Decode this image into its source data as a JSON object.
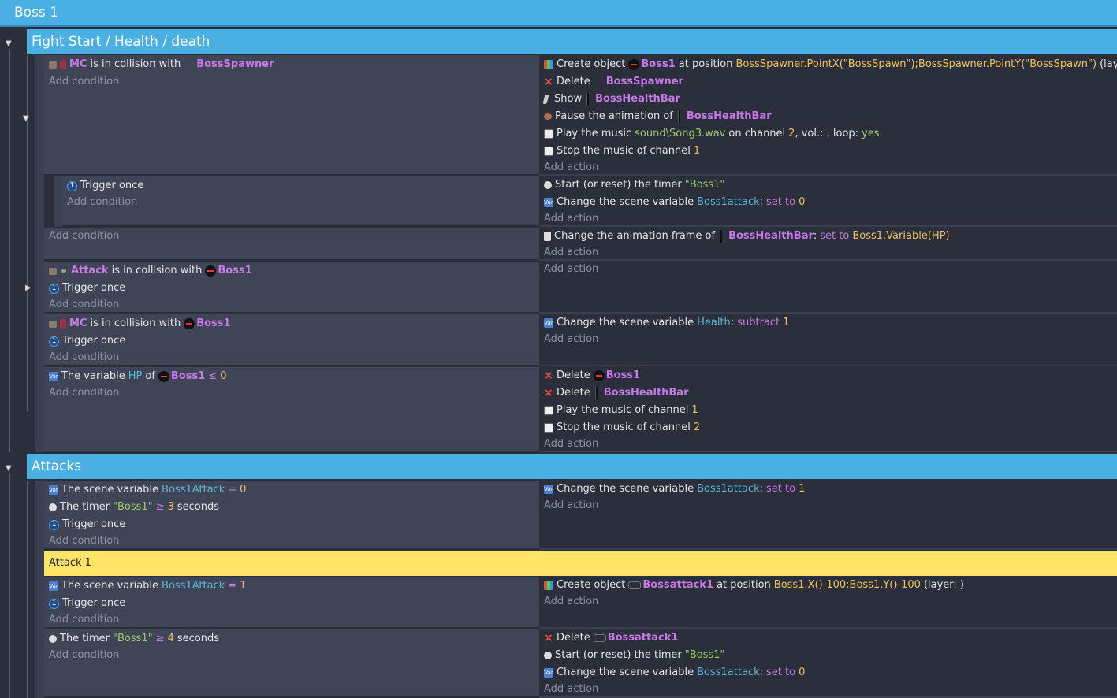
{
  "groups": {
    "top": "Boss 1",
    "fight": "Fight Start / Health / death",
    "attacks": "Attacks"
  },
  "comment": "Attack 1",
  "labels": {
    "add_condition": "Add condition",
    "add_action": "Add action"
  },
  "events": {
    "e1": {
      "cond": [
        "MC",
        "is in collision with",
        "BossSpawner"
      ],
      "a1": [
        "Create object",
        "Boss1",
        "at position",
        "BossSpawner.PointX(\"BossSpawn\");BossSpawner.PointY(\"BossSpawn\")",
        "(layer: )"
      ],
      "a2": [
        "Delete",
        "BossSpawner"
      ],
      "a3": [
        "Show",
        "BossHealthBar"
      ],
      "a4": [
        "Pause the animation of",
        "BossHealthBar"
      ],
      "a5": [
        "Play the music",
        "sound\\Song3.wav",
        "on channel",
        "2",
        ", vol.: , loop:",
        "yes"
      ],
      "a6": [
        "Stop the music of channel",
        "1"
      ]
    },
    "e1s": {
      "cond": "Trigger once",
      "a1": [
        "Start (or reset) the timer",
        "\"Boss1\""
      ],
      "a2": [
        "Change the scene variable",
        "Boss1attack",
        ":",
        "set to",
        "0"
      ]
    },
    "e2": {
      "a1": [
        "Change the animation frame of",
        "BossHealthBar",
        ":",
        "set to",
        "Boss1.Variable(HP)"
      ]
    },
    "e3": {
      "c1": [
        "Attack",
        "is in collision with",
        "Boss1"
      ],
      "c2": "Trigger once"
    },
    "e4": {
      "c1": [
        "MC",
        "is in collision with",
        "Boss1"
      ],
      "c2": "Trigger once",
      "a1": [
        "Change the scene variable",
        "Health",
        ":",
        "subtract",
        "1"
      ]
    },
    "e5": {
      "c1": [
        "The variable",
        "HP",
        "of",
        "Boss1",
        "≤",
        "0"
      ],
      "a1": [
        "Delete",
        "Boss1"
      ],
      "a2": [
        "Delete",
        "BossHealthBar"
      ],
      "a3": [
        "Play the music of channel",
        "1"
      ],
      "a4": [
        "Stop the music of channel",
        "2"
      ]
    },
    "e6": {
      "c1": [
        "The scene variable",
        "Boss1Attack",
        "=",
        "0"
      ],
      "c2": [
        "The timer",
        "\"Boss1\"",
        "≥",
        "3",
        "seconds"
      ],
      "c3": "Trigger once",
      "a1": [
        "Change the scene variable",
        "Boss1attack",
        ":",
        "set to",
        "1"
      ]
    },
    "e7": {
      "c1": [
        "The scene variable",
        "Boss1Attack",
        "=",
        "1"
      ],
      "c2": "Trigger once",
      "a1": [
        "Create object",
        "Bossattack1",
        "at position",
        "Boss1.X()-100;Boss1.Y()-100",
        "(layer: )"
      ]
    },
    "e8": {
      "c1": [
        "The timer",
        "\"Boss1\"",
        "≥",
        "4",
        "seconds"
      ],
      "a1": [
        "Delete",
        "Bossattack1"
      ],
      "a2": [
        "Start (or reset) the timer",
        "\"Boss1\""
      ],
      "a3": [
        "Change the scene variable",
        "Boss1attack",
        ":",
        "set to",
        "0"
      ]
    }
  }
}
